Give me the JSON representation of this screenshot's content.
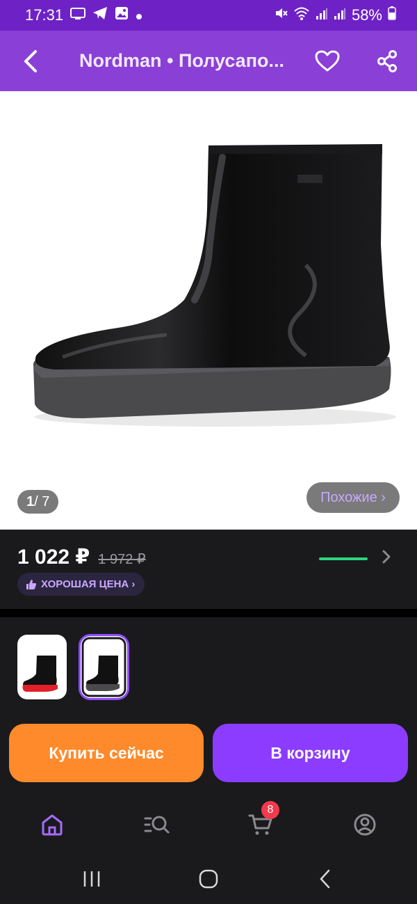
{
  "status_bar": {
    "time": "17:31",
    "battery": "58%"
  },
  "header": {
    "title": "Nordman • Полусапо..."
  },
  "gallery": {
    "current": "1",
    "total": "/ 7",
    "similar_label": "Похожие ›"
  },
  "pricing": {
    "price": "1 022 ₽",
    "old_price": "1 972 ₽",
    "good_price_label": "ХОРОШАЯ ЦЕНА ›"
  },
  "actions": {
    "buy_now": "Купить сейчас",
    "add_to_cart": "В корзину"
  },
  "bottom_nav": {
    "items": [
      {
        "icon": "home-icon",
        "active": true
      },
      {
        "icon": "catalog-search-icon",
        "active": false
      },
      {
        "icon": "cart-icon",
        "active": false,
        "badge": "8"
      },
      {
        "icon": "profile-icon",
        "active": false
      }
    ]
  },
  "colors": {
    "accent": "#8a3fd6",
    "buy": "#ff8a2b",
    "cart": "#8b3cff",
    "good_price_text": "#c9a8ff",
    "price_indicator": "#2bd67b"
  }
}
